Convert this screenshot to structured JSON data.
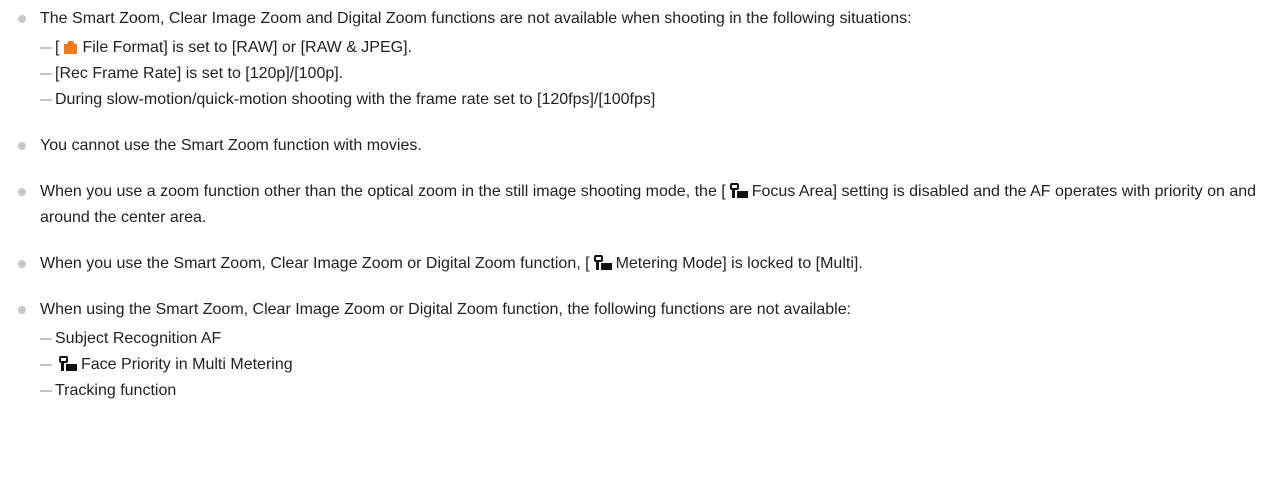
{
  "notes": [
    {
      "text": "The Smart Zoom, Clear Image Zoom and Digital Zoom functions are not available when shooting in the following situations:",
      "items": [
        {
          "before": "[",
          "icon": "camera-icon",
          "after": "File Format] is set to [RAW] or [RAW & JPEG]."
        },
        {
          "text": "[Rec Frame Rate] is set to [120p]/[100p]."
        },
        {
          "text": "During slow-motion/quick-motion shooting with the frame rate set to [120fps]/[100fps]"
        }
      ]
    },
    {
      "text": "You cannot use the Smart Zoom function with movies."
    },
    {
      "before": "When you use a zoom function other than the optical zoom in the still image shooting mode, the [",
      "icon": "still-movie-mode-icon",
      "after": "Focus Area] setting is disabled and the AF operates with priority on and around the center area."
    },
    {
      "before": "When you use the Smart Zoom, Clear Image Zoom or Digital Zoom function, [",
      "icon": "still-movie-mode-icon",
      "after": "Metering Mode] is locked to [Multi]."
    },
    {
      "text": "When using the Smart Zoom, Clear Image Zoom or Digital Zoom function, the following functions are not available:",
      "items": [
        {
          "text": "Subject Recognition AF"
        },
        {
          "icon": "still-movie-mode-icon",
          "after": "Face Priority in Multi Metering"
        },
        {
          "text": "Tracking function"
        }
      ]
    }
  ]
}
